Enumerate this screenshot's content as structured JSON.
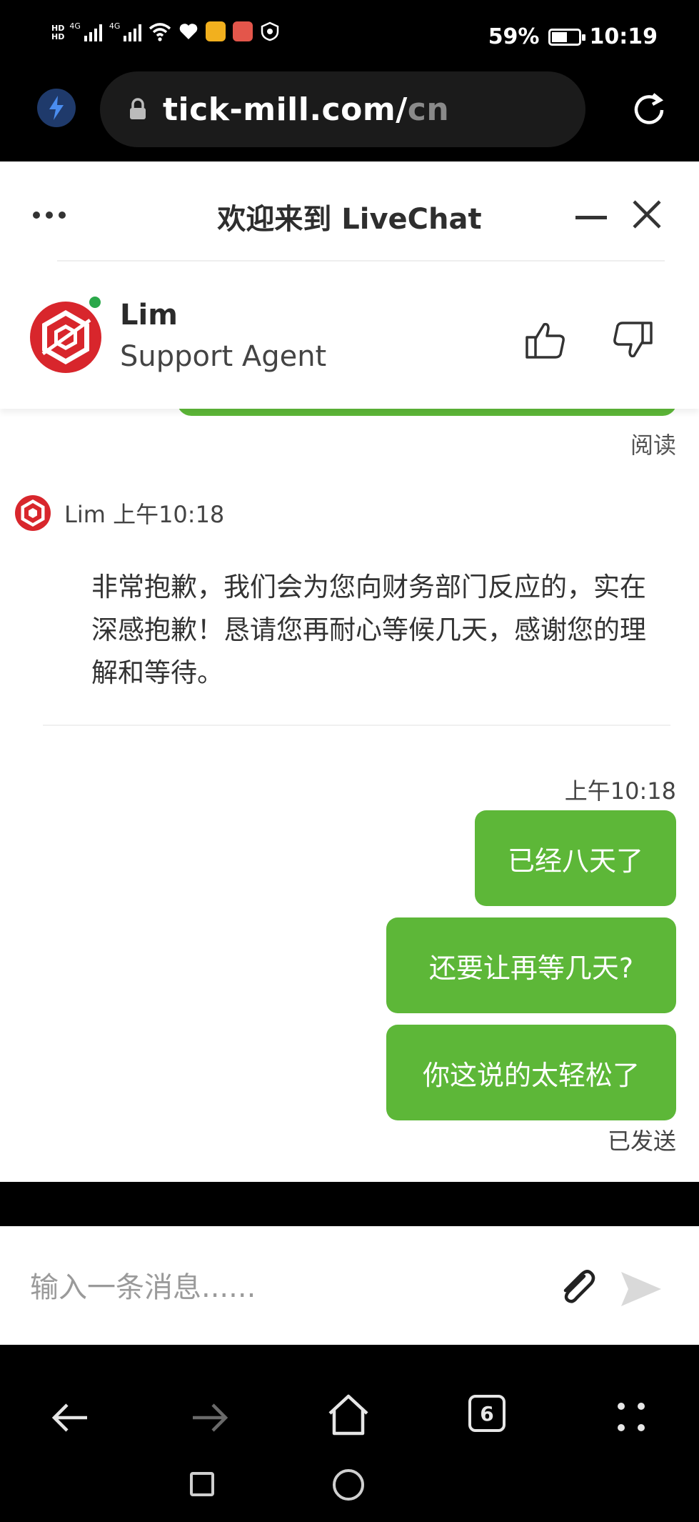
{
  "status_bar": {
    "network_left": "4G",
    "network_right": "4G",
    "battery_percent": "59%",
    "battery_level": 0.59,
    "time": "10:19"
  },
  "browser": {
    "url_host": "tick-mill.com/",
    "url_path": "cn",
    "tab_count": "6"
  },
  "chat_header": {
    "title": "欢迎来到 LiveChat"
  },
  "agent": {
    "name": "Lim",
    "role": "Support Agent",
    "online_color": "#2aa84a"
  },
  "conversation": {
    "read_status": "阅读",
    "agent_message": {
      "author_time": "Lim 上午10:18",
      "text": "非常抱歉，我们会为您向财务部门反应的，实在深感抱歉！恳请您再耐心等候几天，感谢您的理解和等待。"
    },
    "my_time": "上午10:18",
    "my_messages": [
      "已经八天了",
      "还要让再等几天?",
      "你这说的太轻松了"
    ],
    "sent_status": "已发送",
    "bubble_color": "#5db738"
  },
  "composer": {
    "placeholder": "输入一条消息......"
  },
  "icons": {
    "status": [
      "signal-icon",
      "wifi-icon",
      "heart-icon",
      "mail-app-icon",
      "app-icon",
      "shield-icon",
      "battery-icon"
    ],
    "browser": [
      "bolt-icon",
      "lock-icon",
      "reload-icon"
    ],
    "header": [
      "more-icon",
      "minimize-icon",
      "close-icon"
    ],
    "agent": [
      "thumbs-up-icon",
      "thumbs-down-icon"
    ],
    "composer": [
      "paperclip-icon",
      "send-icon"
    ],
    "nav": [
      "back-icon",
      "forward-icon",
      "home-icon",
      "tabs-icon",
      "more-grid-icon"
    ]
  }
}
